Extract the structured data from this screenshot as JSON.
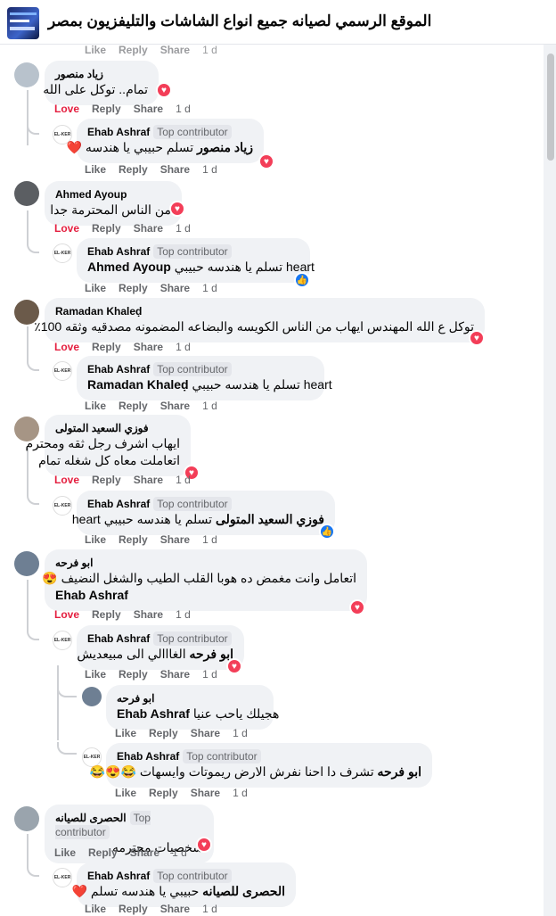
{
  "header": {
    "title": "الموقع الرسمي لصيانه جميع انواع الشاشات والتليفزيون بمصر"
  },
  "actions": {
    "love": "Love",
    "like": "Like",
    "reply": "Reply",
    "share": "Share",
    "time": "1 d"
  },
  "badge": "Top contributor",
  "comments": {
    "c1": {
      "author": "زياد منصور",
      "text": "تمام.. توكل على الله"
    },
    "c1r": {
      "author": "Ehab Ashraf",
      "mention": "زياد منصور",
      "text": "تسلم حبيبي يا هندسه ❤️"
    },
    "c2": {
      "author": "Ahmed Ayoup",
      "text": "من الناس المحترمة جدا"
    },
    "c2r": {
      "author": "Ehab Ashraf",
      "mention": "Ahmed Ayoup",
      "text": "تسلم يا هندسه حبيبي heart"
    },
    "c3": {
      "author": "Ramadan Khaleḍ",
      "text": "توكل ع الله المهندس ايهاب من الناس الكويسه والبضاعه المضمونه مصدقيه وثقه 100٪"
    },
    "c3r": {
      "author": "Ehab Ashraf",
      "mention": "Ramadan Khaleḍ",
      "text": "تسلم يا هندسه حبيبي heart"
    },
    "c4": {
      "author": "فوزي السعيد المتولى",
      "line1": "ايهاب اشرف رجل ثقه ومحترم",
      "line2": "اتعاملت معاه كل شغله تمام"
    },
    "c4r": {
      "author": "Ehab Ashraf",
      "mention": "فوزي السعيد المتولى",
      "text": "تسلم يا هندسه حبيبي heart"
    },
    "c5": {
      "author": "ابو فرحه",
      "line1": "اتعامل وانت مغمض ده هوبا القلب الطيب والشغل النضيف 😍",
      "mention": "Ehab Ashraf"
    },
    "c5r": {
      "author": "Ehab Ashraf",
      "mention": "ابو فرحه",
      "text": "الغااالي الى مبيعديش"
    },
    "c5r2": {
      "author": "ابو فرحه",
      "mention": "Ehab Ashraf",
      "text": "هجيلك ياحب عنيا"
    },
    "c5r3": {
      "author": "Ehab Ashraf",
      "mention": "ابو فرحه",
      "text": "تشرف دا احنا نفرش الارض ريموتات وايسهات 😂😍😂"
    },
    "c6": {
      "author": "الحصرى للصيانه",
      "text": "شخصيات محترمه"
    },
    "c6r": {
      "author": "Ehab Ashraf",
      "mention": "الحصرى للصيانه",
      "text": "حبيبي يا هندسه تسلم ❤️"
    }
  },
  "colors": {
    "love": "#e41e3f",
    "like_react": "#1877f2",
    "heart_react": "#f33e58",
    "bubble": "#f0f2f5"
  }
}
